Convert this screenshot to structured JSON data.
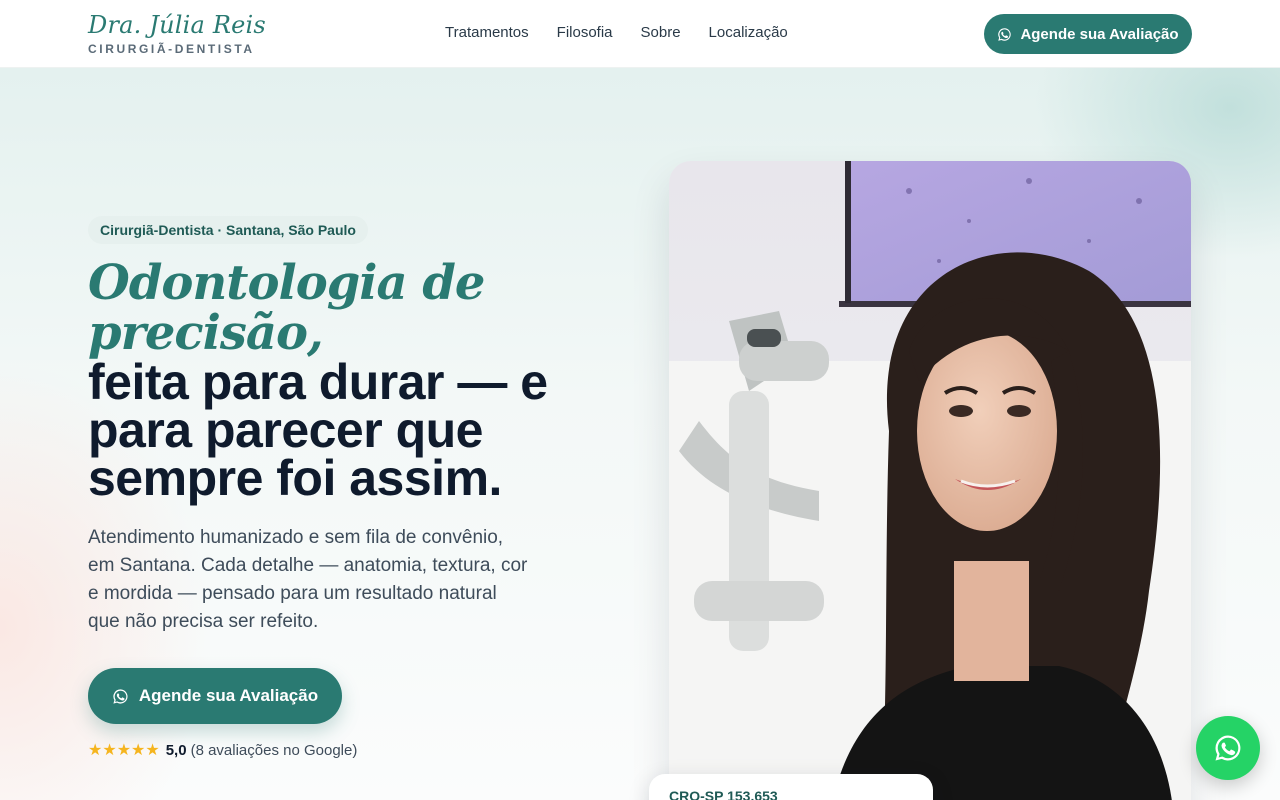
{
  "header": {
    "logo_name": "Dra. Júlia Reis",
    "logo_subtitle": "CIRURGIÃ-DENTISTA",
    "nav": [
      "Tratamentos",
      "Filosofia",
      "Sobre",
      "Localização"
    ],
    "cta_label": "Agende sua Avaliação"
  },
  "hero": {
    "badge": "Cirurgiã-Dentista · Santana, São Paulo",
    "headline_italic": [
      "Odontologia de",
      "precisão,"
    ],
    "headline_bold": [
      "feita para durar — e",
      "para parecer que",
      "sempre foi assim."
    ],
    "lead": [
      "Atendimento humanizado e sem fila de convênio,",
      "em Santana. Cada detalhe — anatomia, textura, cor",
      "e mordida — pensado para um resultado natural",
      "que não precisa ser refeito."
    ],
    "cta_label": "Agende sua Avaliação",
    "rating": {
      "stars": 5,
      "stars_display": "★★★★★",
      "value": "5,0",
      "text": "(8 avaliações no Google)"
    },
    "photo_alt": "Dra. Júlia Reis em consultório odontológico",
    "cro": "CRO-SP 153.653"
  },
  "colors": {
    "brand": "#2a7a72",
    "heading": "#0f1b2d",
    "whatsapp": "#25d366",
    "star": "#f5b51f"
  },
  "icons": {
    "whatsapp": "whatsapp-icon",
    "star": "star-icon"
  }
}
